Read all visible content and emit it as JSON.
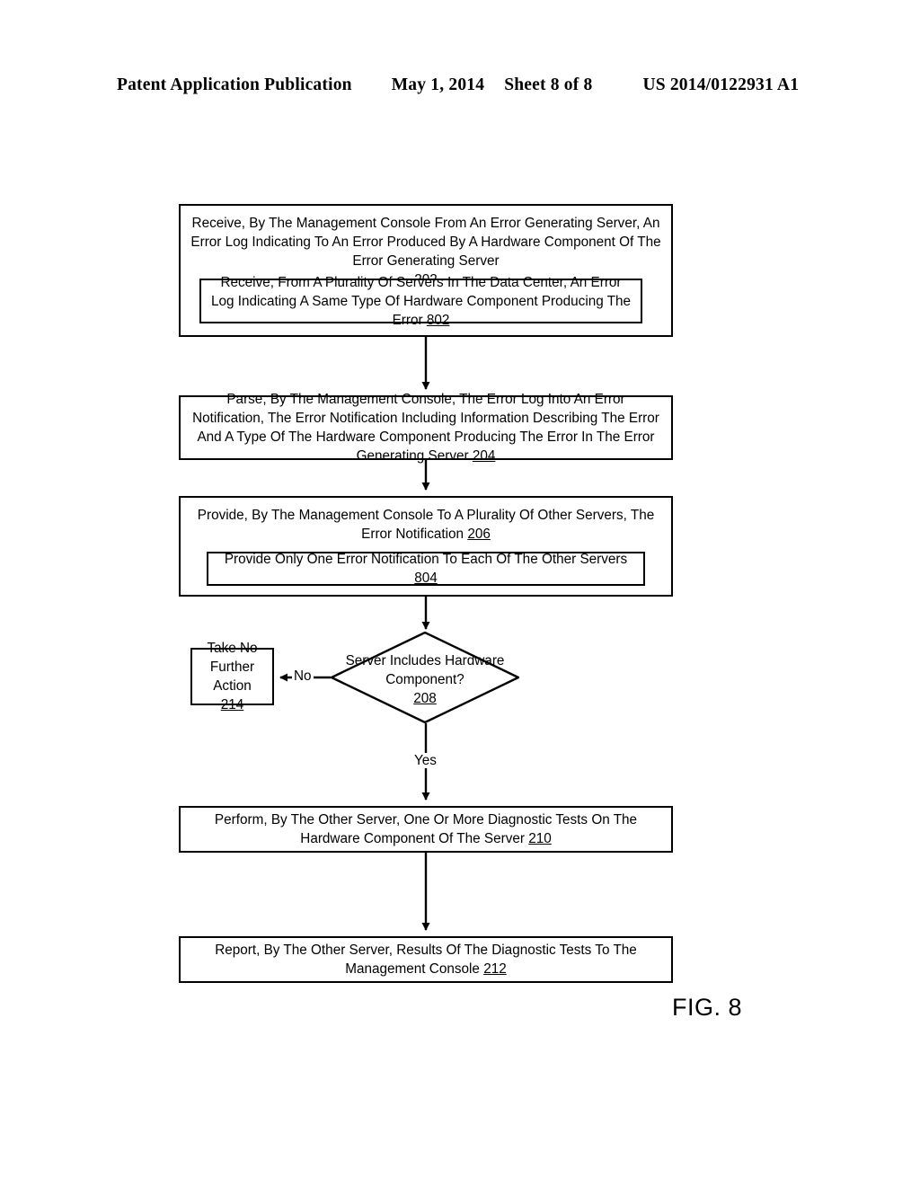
{
  "header": {
    "publication": "Patent Application Publication",
    "date": "May 1, 2014",
    "sheet": "Sheet 8 of 8",
    "number": "US 2014/0122931 A1"
  },
  "figure": {
    "caption": "FIG. 8"
  },
  "flowchart": {
    "nodes": {
      "n202": {
        "text": "Receive, By The Management Console From An Error Generating Server, An Error Log Indicating To An Error Produced By A Hardware Component Of The Error Generating Server",
        "ref": "202",
        "shape": "process"
      },
      "n802": {
        "text": "Receive, From A Plurality Of Servers In The Data Center, An Error Log Indicating A Same Type Of Hardware Component Producing The Error",
        "ref": "802",
        "shape": "process"
      },
      "n204": {
        "text": "Parse, By The Management Console, The Error Log Into An Error Notification, The Error Notification Including Information Describing The Error And A Type Of The Hardware Component Producing The Error In The Error Generating Server",
        "ref": "204",
        "shape": "process"
      },
      "n206": {
        "text": "Provide, By The Management Console To A Plurality Of Other Servers, The Error Notification",
        "ref": "206",
        "shape": "process"
      },
      "n804": {
        "text": "Provide Only One Error Notification To Each Of The Other Servers",
        "ref": "804",
        "shape": "process"
      },
      "n208": {
        "text": "Server Includes Hardware Component?",
        "ref": "208",
        "shape": "decision"
      },
      "n214": {
        "text": "Take No Further Action",
        "ref": "214",
        "shape": "process"
      },
      "n210": {
        "text": "Perform, By The Other Server, One Or More Diagnostic Tests On The Hardware Component Of The Server",
        "ref": "210",
        "shape": "process"
      },
      "n212": {
        "text": "Report, By The Other Server, Results Of The Diagnostic Tests To The Management Console",
        "ref": "212",
        "shape": "process"
      }
    },
    "branch_labels": {
      "no": "No",
      "yes": "Yes"
    }
  }
}
